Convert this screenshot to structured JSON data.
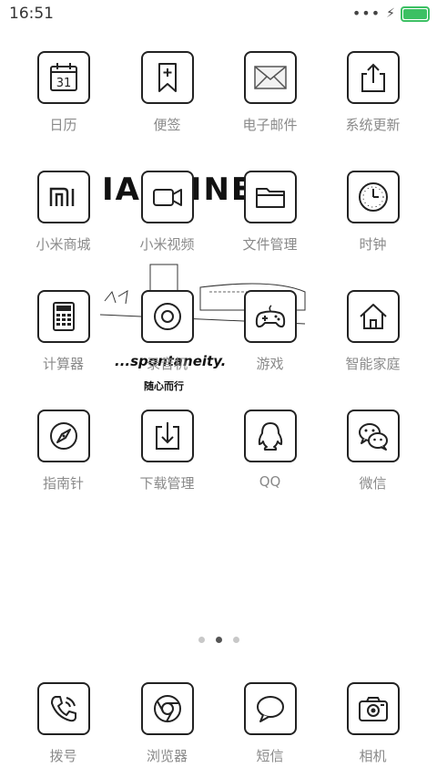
{
  "status_bar": {
    "time": "16:51",
    "signal": "•••",
    "charging_icon": "bolt-icon",
    "battery_color": "#3cc063",
    "battery_level": 1.0
  },
  "wallpaper": {
    "headline": "IAPPINESS",
    "caption": "...spontaneity.",
    "caption_cn": "随心而行"
  },
  "apps": [
    {
      "label": "日历",
      "icon": "calendar-icon",
      "day": "31"
    },
    {
      "label": "便签",
      "icon": "notes-icon"
    },
    {
      "label": "电子邮件",
      "icon": "mail-icon"
    },
    {
      "label": "系统更新",
      "icon": "update-icon"
    },
    {
      "label": "小米商城",
      "icon": "mi-store-icon",
      "logo": "mi"
    },
    {
      "label": "小米视频",
      "icon": "video-icon"
    },
    {
      "label": "文件管理",
      "icon": "folder-icon"
    },
    {
      "label": "时钟",
      "icon": "clock-icon"
    },
    {
      "label": "计算器",
      "icon": "calculator-icon"
    },
    {
      "label": "录音机",
      "icon": "recorder-icon"
    },
    {
      "label": "游戏",
      "icon": "gamepad-icon"
    },
    {
      "label": "智能家庭",
      "icon": "home-icon"
    },
    {
      "label": "指南针",
      "icon": "compass-icon"
    },
    {
      "label": "下载管理",
      "icon": "download-icon"
    },
    {
      "label": "QQ",
      "icon": "qq-icon"
    },
    {
      "label": "微信",
      "icon": "wechat-icon"
    }
  ],
  "page_indicator": {
    "count": 3,
    "active": 2
  },
  "dock": [
    {
      "label": "拨号",
      "icon": "phone-icon"
    },
    {
      "label": "浏览器",
      "icon": "browser-icon"
    },
    {
      "label": "短信",
      "icon": "message-icon"
    },
    {
      "label": "相机",
      "icon": "camera-icon"
    }
  ]
}
